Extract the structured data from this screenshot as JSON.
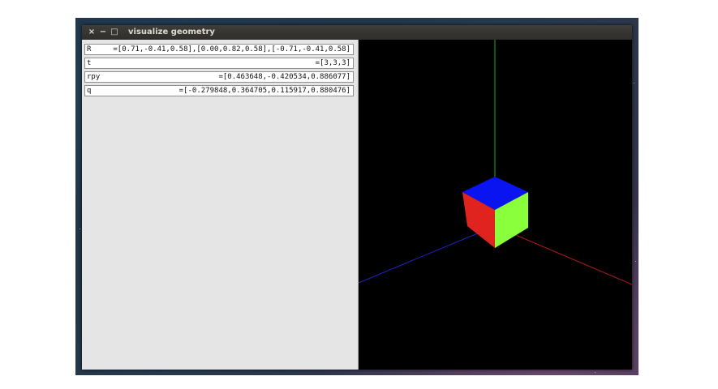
{
  "window": {
    "title": "visualize geometry",
    "close_symbol": "×",
    "minimize_symbol": "−",
    "maximize_symbol": "□"
  },
  "fields": [
    {
      "label": "R",
      "value": "=[0.71,-0.41,0.58],[0.00,0.82,0.58],[-0.71,-0.41,0.58]"
    },
    {
      "label": "t",
      "value": "=[3,3,3]"
    },
    {
      "label": "rpy",
      "value": "=[0.463648,-0.420534,0.886077]"
    },
    {
      "label": "q",
      "value": "=[-0.279848,0.364705,0.115917,0.880476]"
    }
  ],
  "scene": {
    "axis_x_color": "#b01818",
    "axis_y_color": "#1ea81e",
    "axis_z_color": "#2222c8",
    "cube_top_color": "#0a14f0",
    "cube_left_color": "#e0231e",
    "cube_right_color": "#8aff3c"
  }
}
